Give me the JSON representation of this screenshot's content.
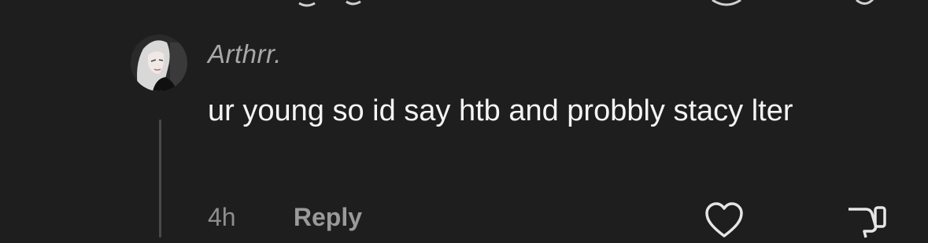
{
  "comment": {
    "username": "Arthrr.",
    "text": "ur young so id say htb and probbly stacy lter",
    "timestamp": "4h",
    "reply_label": "Reply"
  },
  "icons": {
    "avatar": "profile-avatar",
    "like": "heart-icon",
    "dislike": "thumbs-down-icon"
  },
  "colors": {
    "background": "#1e1e1e",
    "username": "#a8a8a8",
    "text": "#f4f4f4",
    "meta": "#8e8e8e"
  }
}
